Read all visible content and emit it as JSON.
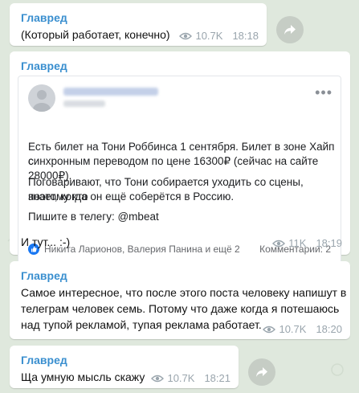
{
  "messages": [
    {
      "sender": "Главред",
      "text": "(Который работает, конечно)",
      "views": "10.7K",
      "time": "18:18"
    },
    {
      "sender": "Главред",
      "embed": {
        "author_name_blurred": "",
        "post_lines": [
          "Есть билет на Тони Роббинса 1 сентября. Билет в зоне Хайп с",
          "синхронным переводом по цене 16300₽ (сейчас на сайте 28000₽)."
        ],
        "post_lines2": [
          "Поговаривают, что Тони собирается уходить со сцены, поэтому кто",
          "знает, когда он ещё соберётся в Россию."
        ],
        "post_line3": "Пишите в телегу: @mbeat",
        "reactions_text": "Никита Ларионов, Валерия Панина и ещё 2",
        "comments_text": "Комментарии: 2"
      },
      "text": "И тут... :-)",
      "views": "11K",
      "time": "18:19"
    },
    {
      "sender": "Главред",
      "lines": [
        "Самое интересное, что после этого поста человеку напишут в",
        "телеграм человек семь. Потому что даже когда я потешаюсь",
        "над тупой рекламой, тупая реклама работает."
      ],
      "views": "10.7K",
      "time": "18:20"
    },
    {
      "sender": "Главред",
      "text": "Ща умную мысль скажу",
      "views": "10.7K",
      "time": "18:21"
    }
  ],
  "colors": {
    "background": "#dfe8dd",
    "sender": "#3a8fcf",
    "meta": "#9aa5ad",
    "facebook_blue": "#1877f2"
  },
  "icons": [
    "eye-icon",
    "share-arrow-icon",
    "like-icon"
  ]
}
